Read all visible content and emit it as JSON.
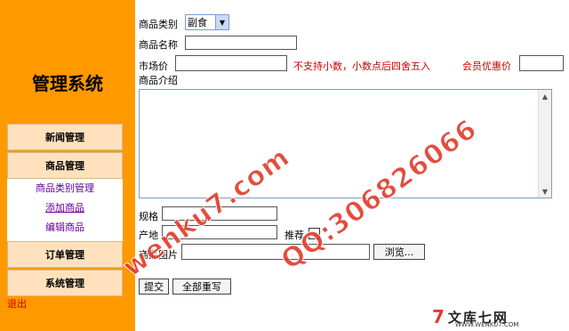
{
  "sidebar": {
    "title": "管理系统",
    "menus": {
      "news": "新闻管理",
      "goods": "商品管理",
      "orders": "订单管理",
      "system": "系统管理"
    },
    "submenu": [
      "商品类别管理",
      "添加商品",
      "编辑商品"
    ],
    "logout": "退出"
  },
  "form": {
    "category_label": "商品类别",
    "category_value": "副食",
    "name_label": "商品名称",
    "market_price_label": "市场价",
    "price_note": "不支持小数，小数点后四舍五入",
    "member_price_label": "会员优惠价",
    "intro_label": "商品介绍",
    "spec_label": "规格",
    "origin_label": "产地",
    "recommend_label": "推荐",
    "image_label": "商品图片",
    "browse_button": "浏览...",
    "submit_button": "提交",
    "reset_button": "全部重写"
  },
  "watermark": {
    "text1": "wenku7.com",
    "text2": "QQ:306826066",
    "logo_mark": "7",
    "logo_name": "文库七网",
    "logo_url": "WWW.WENKU7.COM"
  },
  "colors": {
    "sidebar_bg": "#ff9900",
    "menu_box_bg": "#ffe2bd",
    "note_red": "#cc0000",
    "submenu_purple": "#660099"
  }
}
